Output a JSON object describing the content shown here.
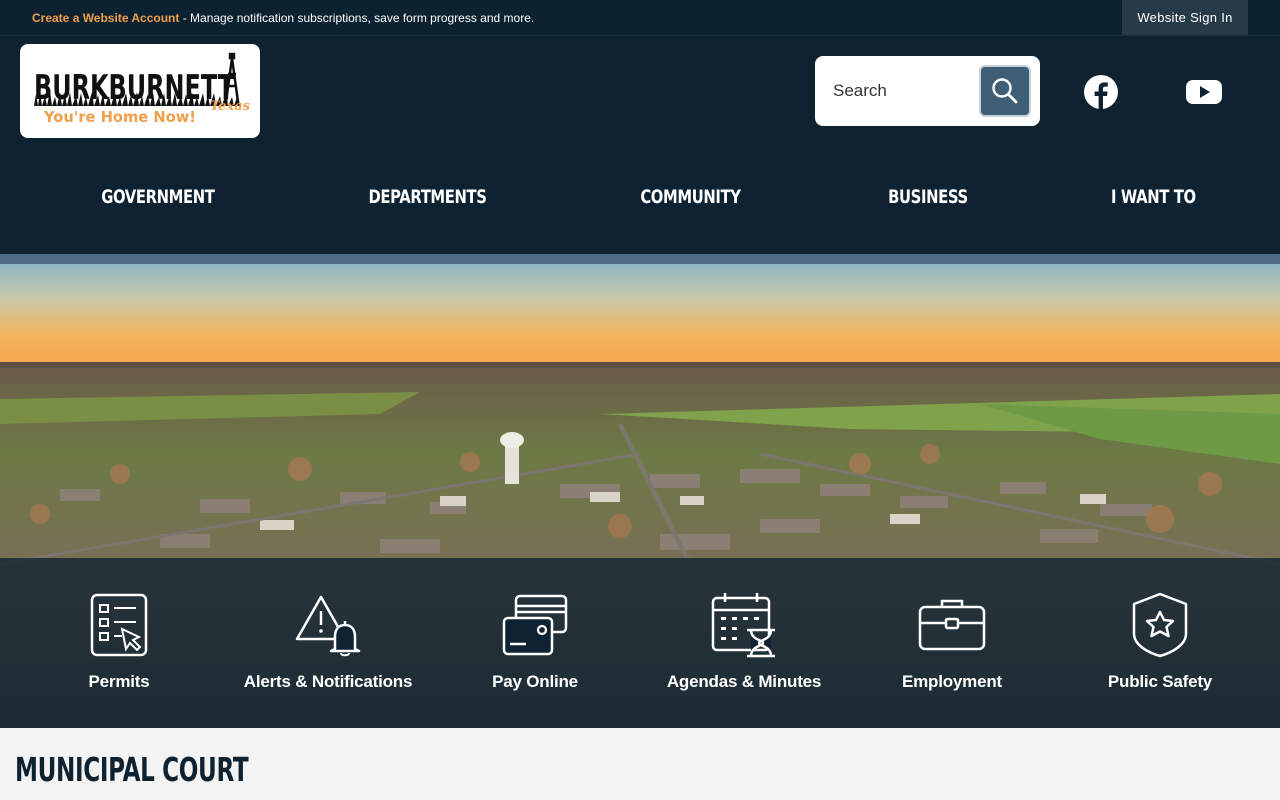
{
  "topbar": {
    "create_account_link": "Create a Website Account",
    "message": " - Manage notification subscriptions, save form progress and more.",
    "signin_label": "Website Sign In"
  },
  "logo": {
    "name": "BURKBURNETT",
    "state": "Texas",
    "tagline": "You're Home Now!"
  },
  "search": {
    "placeholder": "Search",
    "icon": "search-icon"
  },
  "social": [
    {
      "name": "facebook-icon"
    },
    {
      "name": "youtube-icon"
    }
  ],
  "nav": {
    "items": [
      "GOVERNMENT",
      "DEPARTMENTS",
      "COMMUNITY",
      "BUSINESS",
      "I WANT TO"
    ]
  },
  "quicklinks": [
    {
      "label": "Permits",
      "icon": "permits-checklist-icon"
    },
    {
      "label": "Alerts & Notifications",
      "icon": "alert-bell-icon"
    },
    {
      "label": "Pay Online",
      "icon": "credit-card-icon"
    },
    {
      "label": "Agendas & Minutes",
      "icon": "calendar-hourglass-icon"
    },
    {
      "label": "Employment",
      "icon": "briefcase-icon"
    },
    {
      "label": "Public Safety",
      "icon": "shield-star-icon"
    }
  ],
  "page": {
    "title": "MUNICIPAL COURT"
  },
  "colors": {
    "header_bg": "#0e2231",
    "accent_orange": "#f0a04b",
    "search_button": "#3d5e74"
  }
}
